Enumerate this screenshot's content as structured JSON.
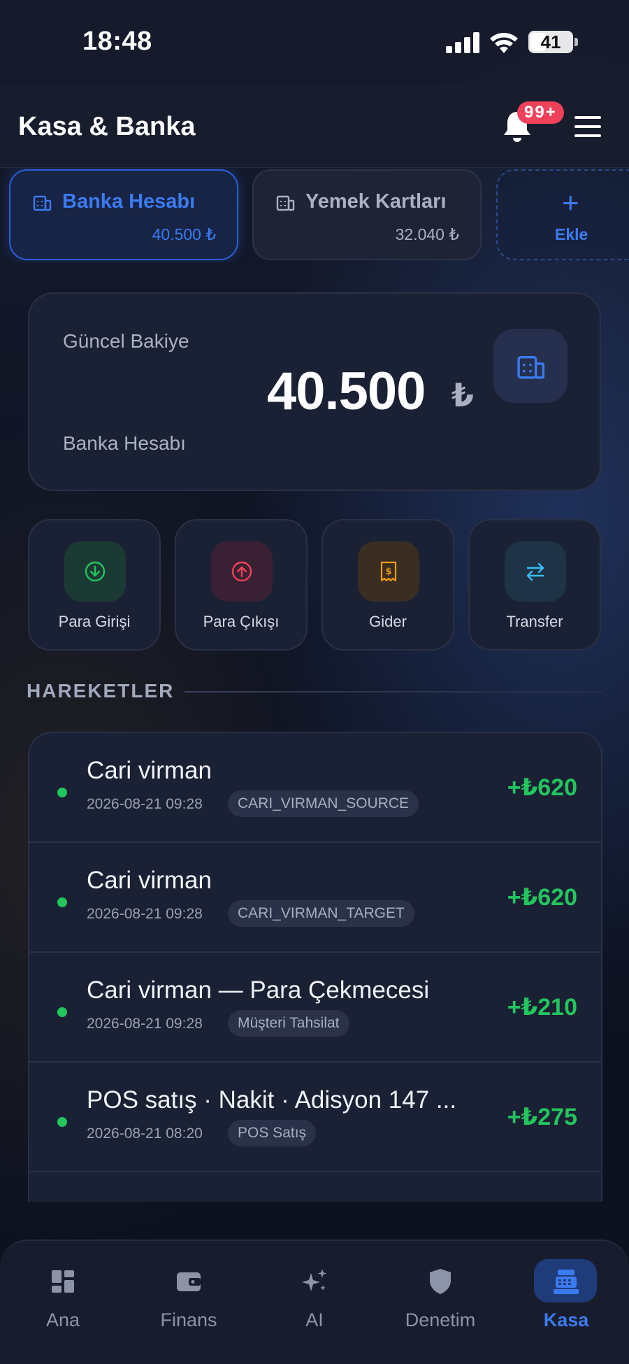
{
  "status_bar": {
    "time": "18:48",
    "battery": "41"
  },
  "header": {
    "title": "Kasa & Banka",
    "notification_badge": "99+"
  },
  "accounts": [
    {
      "name": "Banka Hesabı",
      "amount": "40.500 ₺",
      "active": true
    },
    {
      "name": "Yemek Kartları",
      "amount": "32.040 ₺",
      "active": false
    }
  ],
  "add_account": {
    "label": "Ekle",
    "icon": "plus-icon"
  },
  "balance": {
    "label": "Güncel Bakiye",
    "value": "40.500",
    "currency": "₺",
    "account_name": "Banka Hesabı"
  },
  "actions": [
    {
      "label": "Para Girişi",
      "icon": "arrow-down-circle-icon",
      "color": "#22c55e"
    },
    {
      "label": "Para Çıkışı",
      "icon": "arrow-up-circle-icon",
      "color": "#f0415a"
    },
    {
      "label": "Gider",
      "icon": "receipt-icon",
      "color": "#f59e0b"
    },
    {
      "label": "Transfer",
      "icon": "transfer-arrows-icon",
      "color": "#38bdf8"
    }
  ],
  "section": {
    "title": "HAREKETLER"
  },
  "transactions": [
    {
      "title": "Cari virman",
      "date": "2026-08-21 09:28",
      "tag": "CARI_VIRMAN_SOURCE",
      "amount": "+₺620"
    },
    {
      "title": "Cari virman",
      "date": "2026-08-21 09:28",
      "tag": "CARI_VIRMAN_TARGET",
      "amount": "+₺620"
    },
    {
      "title": "Cari virman — Para Çekmecesi",
      "date": "2026-08-21 09:28",
      "tag": "Müşteri Tahsilat",
      "amount": "+₺210"
    },
    {
      "title": "POS satış · Nakit · Adisyon 147 ...",
      "date": "2026-08-21 08:20",
      "tag": "POS Satış",
      "amount": "+₺275"
    }
  ],
  "nav": [
    {
      "label": "Ana",
      "icon": "dashboard-grid-icon",
      "active": false
    },
    {
      "label": "Finans",
      "icon": "wallet-icon",
      "active": false
    },
    {
      "label": "AI",
      "icon": "sparkles-icon",
      "active": false
    },
    {
      "label": "Denetim",
      "icon": "shield-icon",
      "active": false
    },
    {
      "label": "Kasa",
      "icon": "cash-register-icon",
      "active": true
    }
  ],
  "colors": {
    "accent": "#3b7bf0",
    "positive": "#22c55e",
    "badge": "#f0415a"
  }
}
